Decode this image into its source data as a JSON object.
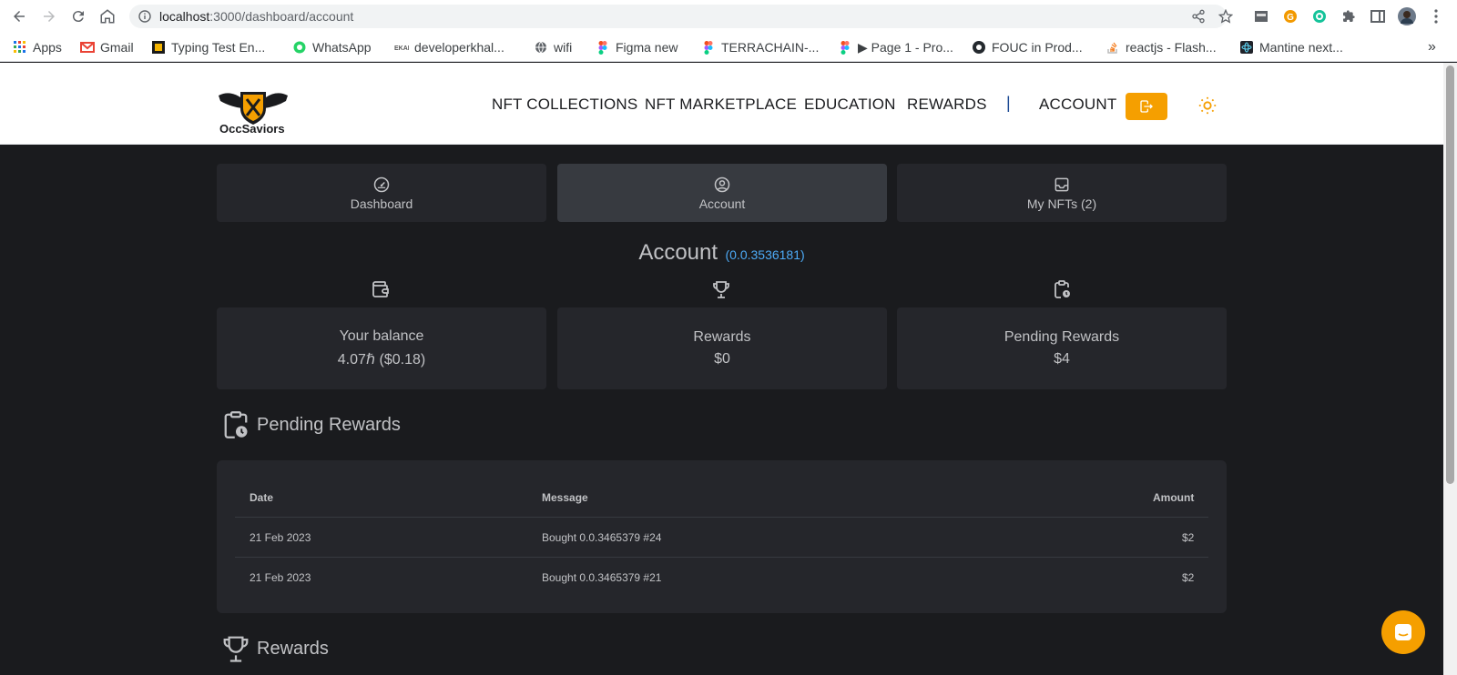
{
  "browser": {
    "url_host": "localhost",
    "url_rest": ":3000/dashboard/account",
    "bookmarks": [
      {
        "label": "Apps",
        "icon": "apps-grid-icon",
        "color": "#1a73e8"
      },
      {
        "label": "Gmail",
        "icon": "gmail-icon",
        "color": "#ea4335"
      },
      {
        "label": "Typing Test En...",
        "icon": "typing-test-icon",
        "color": "#000000"
      },
      {
        "label": "WhatsApp",
        "icon": "whatsapp-icon",
        "color": "#25d366"
      },
      {
        "label": "developerkhal...",
        "icon": "ekal-icon",
        "color": "#555555"
      },
      {
        "label": "wifi",
        "icon": "globe-icon",
        "color": "#5f6368"
      },
      {
        "label": "Figma new",
        "icon": "figma-icon",
        "color": "#f24e1e"
      },
      {
        "label": "TERRACHAIN-...",
        "icon": "figma-icon",
        "color": "#f24e1e"
      },
      {
        "label": "▶ Page 1 - Pro...",
        "icon": "figma-icon",
        "color": "#f24e1e"
      },
      {
        "label": "FOUC in Prod...",
        "icon": "github-icon",
        "color": "#24292e"
      },
      {
        "label": "reactjs - Flash...",
        "icon": "stackoverflow-icon",
        "color": "#f48024"
      },
      {
        "label": "Mantine next...",
        "icon": "react-icon",
        "color": "#61dafb"
      }
    ],
    "more_bookmarks": "»"
  },
  "header": {
    "brand": "OccSaviors",
    "nav": [
      "NFT COLLECTIONS",
      "NFT MARKETPLACE",
      "EDUCATION",
      "REWARDS"
    ],
    "separator": "|",
    "account_link": "ACCOUNT",
    "accent_color": "#f59f00"
  },
  "tabs": [
    {
      "label": "Dashboard",
      "icon": "gauge-icon",
      "active": false
    },
    {
      "label": "Account",
      "icon": "user-circle-icon",
      "active": true
    },
    {
      "label": "My NFTs (2)",
      "icon": "inbox-icon",
      "active": false
    }
  ],
  "account": {
    "title": "Account",
    "id": "(0.0.3536181)"
  },
  "stats": [
    {
      "label": "Your balance",
      "value": "4.07ℏ ($0.18)",
      "icon": "wallet-icon"
    },
    {
      "label": "Rewards",
      "value": "$0",
      "icon": "trophy-icon"
    },
    {
      "label": "Pending Rewards",
      "value": "$4",
      "icon": "clipboard-clock-icon"
    }
  ],
  "pending_rewards": {
    "title": "Pending Rewards",
    "columns": [
      "Date",
      "Message",
      "Amount"
    ],
    "rows": [
      {
        "date": "21 Feb 2023",
        "message": "Bought 0.0.3465379 #24",
        "amount": "$2"
      },
      {
        "date": "21 Feb 2023",
        "message": "Bought 0.0.3465379 #21",
        "amount": "$2"
      }
    ]
  },
  "rewards_section": {
    "title": "Rewards"
  }
}
